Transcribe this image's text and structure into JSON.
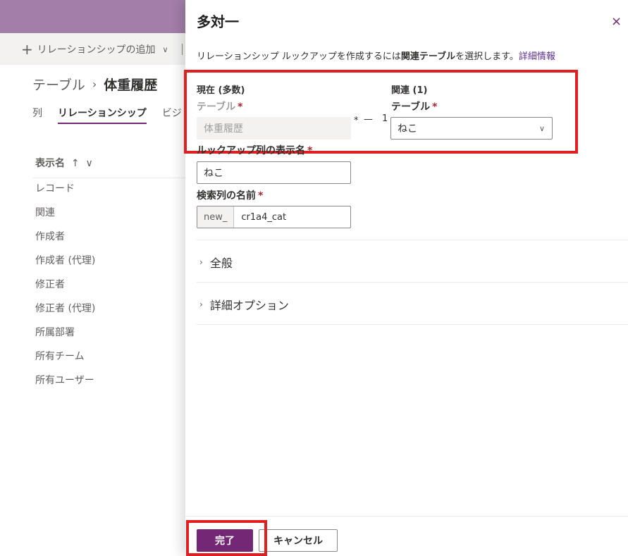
{
  "background": {
    "command": {
      "add_relationship": "リレーションシップの追加"
    },
    "breadcrumb": {
      "root": "テーブル",
      "separator": "›",
      "current": "体重履歴"
    },
    "tabs": [
      "列",
      "リレーションシップ",
      "ビジ"
    ],
    "column_header": {
      "label": "表示名",
      "sort_indicator": "↑",
      "dropdown": "∨"
    },
    "rows": [
      "レコード",
      "関連",
      "作成者",
      "作成者 (代理)",
      "修正者",
      "修正者 (代理)",
      "所属部署",
      "所有チーム",
      "所有ユーザー"
    ]
  },
  "panel": {
    "title": "多対一",
    "close_icon": "×",
    "description": {
      "prefix": "リレーションシップ ルックアップを作成するには",
      "bold": "関連テーブル",
      "suffix": "を選択します。",
      "link": "詳細情報"
    },
    "current": {
      "heading": "現在 (多数)",
      "table_label": "テーブル",
      "table_value": "体重履歴",
      "required": "*"
    },
    "cardinality": {
      "many": "*",
      "dash": "—",
      "one": "1"
    },
    "related": {
      "heading": "関連 (1)",
      "table_label": "テーブル",
      "table_value": "ねこ",
      "required": "*"
    },
    "lookup_display": {
      "label": "ルックアップ列の表示名",
      "value": "ねこ",
      "required": "*"
    },
    "lookup_name": {
      "label": "検索列の名前",
      "prefix": "new_",
      "value": "cr1a4_cat",
      "required": "*"
    },
    "sections": {
      "general": "全般",
      "advanced": "詳細オプション"
    },
    "buttons": {
      "done": "完了",
      "cancel": "キャンセル"
    }
  },
  "colors": {
    "accent": "#742774",
    "highlight": "#e02020",
    "header_bg": "#a27ea8"
  }
}
